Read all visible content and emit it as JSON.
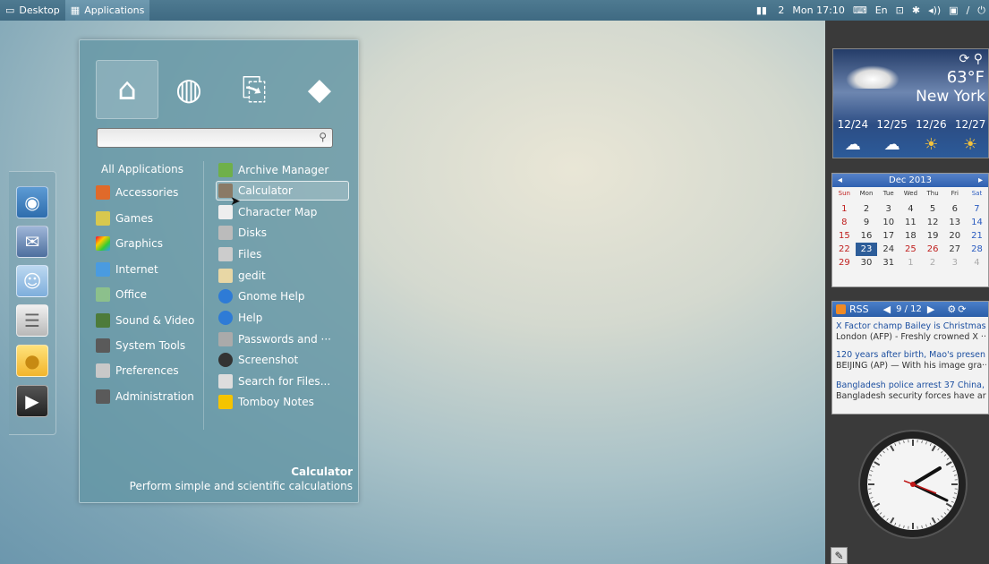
{
  "top_panel": {
    "desktop_label": "Desktop",
    "applications_label": "Applications",
    "workspace": "2",
    "clock": "Mon 17:10",
    "language": "En"
  },
  "dock": {
    "items": [
      "browser-icon",
      "mail-icon",
      "chat-icon",
      "file-cabinet-icon",
      "cheese-icon",
      "video-icon"
    ]
  },
  "app_menu": {
    "category_tabs": [
      "home-icon",
      "globe-icon",
      "folder-icon",
      "diamond-icon"
    ],
    "search": {
      "value": "",
      "placeholder": ""
    },
    "categories": [
      "All Applications",
      "Accessories",
      "Games",
      "Graphics",
      "Internet",
      "Office",
      "Sound & Video",
      "System Tools",
      "Preferences",
      "Administration"
    ],
    "apps": [
      "Archive Manager",
      "Calculator",
      "Character Map",
      "Disks",
      "Files",
      "gedit",
      "Gnome Help",
      "Help",
      "Passwords and ···",
      "Screenshot",
      "Search for Files...",
      "Tomboy Notes"
    ],
    "selected_app": "Calculator",
    "description_title": "Calculator",
    "description_text": "Perform simple and scientific calculations"
  },
  "weather": {
    "temperature": "63°F",
    "city": "New York",
    "days": [
      "12/24",
      "12/25",
      "12/26",
      "12/27"
    ]
  },
  "calendar": {
    "month": "Dec 2013",
    "weekdays": [
      "Sun",
      "Mon",
      "Tue",
      "Wed",
      "Thu",
      "Fri",
      "Sat"
    ],
    "weeks": [
      [
        "1",
        "2",
        "3",
        "4",
        "5",
        "6",
        "7"
      ],
      [
        "8",
        "9",
        "10",
        "11",
        "12",
        "13",
        "14"
      ],
      [
        "15",
        "16",
        "17",
        "18",
        "19",
        "20",
        "21"
      ],
      [
        "22",
        "23",
        "24",
        "25",
        "26",
        "27",
        "28"
      ],
      [
        "29",
        "30",
        "31",
        "1",
        "2",
        "3",
        "4"
      ]
    ],
    "today": "23"
  },
  "rss": {
    "label": "RSS",
    "page": "9 / 12",
    "items": [
      {
        "title": "X Factor champ Bailey is Christmas···",
        "summary": "London (AFP) - Freshly crowned X ···"
      },
      {
        "title": "120 years after birth, Mao's presen···",
        "summary": "BEIJING (AP) — With his image gra···"
      },
      {
        "title": "Bangladesh police arrest 37 China, ···",
        "summary": "Bangladesh security forces have ar···"
      }
    ]
  },
  "colors": {
    "panel": "#3f6a82",
    "menu_bg": "#6496a5",
    "calendar_header": "#2f61b0",
    "today_bg": "#2d5d99"
  }
}
